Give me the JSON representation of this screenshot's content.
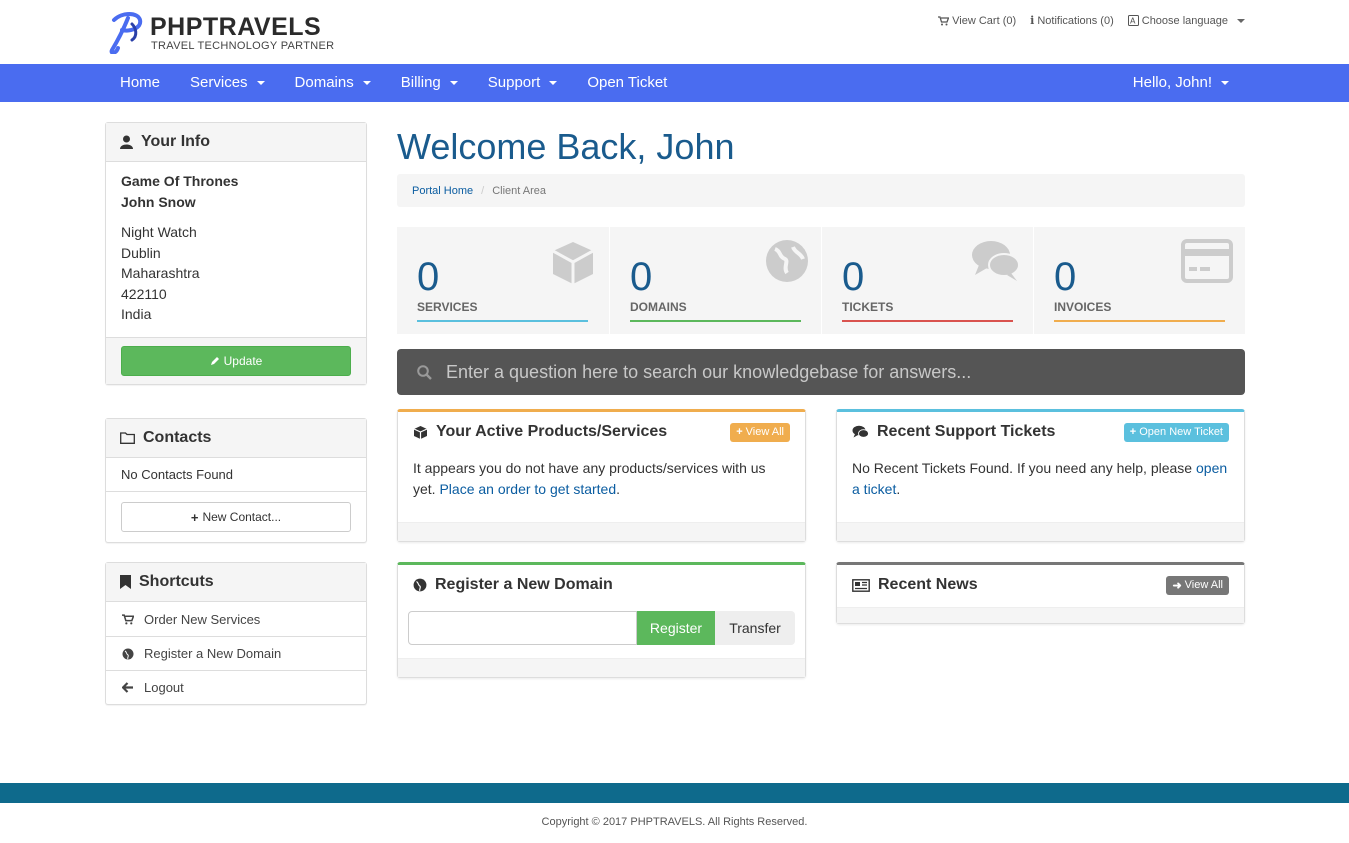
{
  "brand": {
    "name": "PHPTRAVELS",
    "tagline": "TRAVEL TECHNOLOGY PARTNER",
    "accent": "#4a6cf0"
  },
  "toplinks": {
    "cart": "View Cart (0)",
    "notifications": "Notifications (0)",
    "language": "Choose language"
  },
  "nav": {
    "items": [
      {
        "label": "Home"
      },
      {
        "label": "Services"
      },
      {
        "label": "Domains"
      },
      {
        "label": "Billing"
      },
      {
        "label": "Support"
      },
      {
        "label": "Open Ticket"
      }
    ],
    "user": "Hello, John!"
  },
  "sidebar": {
    "info": {
      "title": "Your Info",
      "company": "Game Of Thrones",
      "name": "John Snow",
      "address": [
        "Night Watch",
        "Dublin",
        "Maharashtra",
        "422110",
        "India"
      ],
      "update_label": "Update"
    },
    "contacts": {
      "title": "Contacts",
      "empty": "No Contacts Found",
      "new_label": "New Contact..."
    },
    "shortcuts": {
      "title": "Shortcuts",
      "items": [
        {
          "label": "Order New Services",
          "icon": "cart-icon"
        },
        {
          "label": "Register a New Domain",
          "icon": "globe-icon"
        },
        {
          "label": "Logout",
          "icon": "arrow-left-icon"
        }
      ]
    }
  },
  "main": {
    "title": "Welcome Back, John",
    "breadcrumb": {
      "home": "Portal Home",
      "current": "Client Area"
    },
    "stats": [
      {
        "value": "0",
        "label": "SERVICES",
        "color": "#5bc0de",
        "icon": "cube-icon"
      },
      {
        "value": "0",
        "label": "DOMAINS",
        "color": "#5cb85c",
        "icon": "globe-icon"
      },
      {
        "value": "0",
        "label": "TICKETS",
        "color": "#d9534f",
        "icon": "comments-icon"
      },
      {
        "value": "0",
        "label": "INVOICES",
        "color": "#f0ad4e",
        "icon": "credit-card-icon"
      }
    ],
    "search_placeholder": "Enter a question here to search our knowledgebase for answers...",
    "products": {
      "title": "Your Active Products/Services",
      "button": "View All",
      "text": "It appears you do not have any products/services with us yet.",
      "link": "Place an order to get started",
      "color": "#f0ad4e"
    },
    "tickets": {
      "title": "Recent Support Tickets",
      "button": "Open New Ticket",
      "text": "No Recent Tickets Found. If you need any help, please",
      "link": "open a ticket",
      "color": "#5bc0de"
    },
    "domain": {
      "title": "Register a New Domain",
      "register": "Register",
      "transfer": "Transfer",
      "color": "#5cb85c"
    },
    "news": {
      "title": "Recent News",
      "button": "View All",
      "color": "#777777"
    }
  },
  "footer": {
    "copyright": "Copyright © 2017 PHPTRAVELS. All Rights Reserved."
  }
}
